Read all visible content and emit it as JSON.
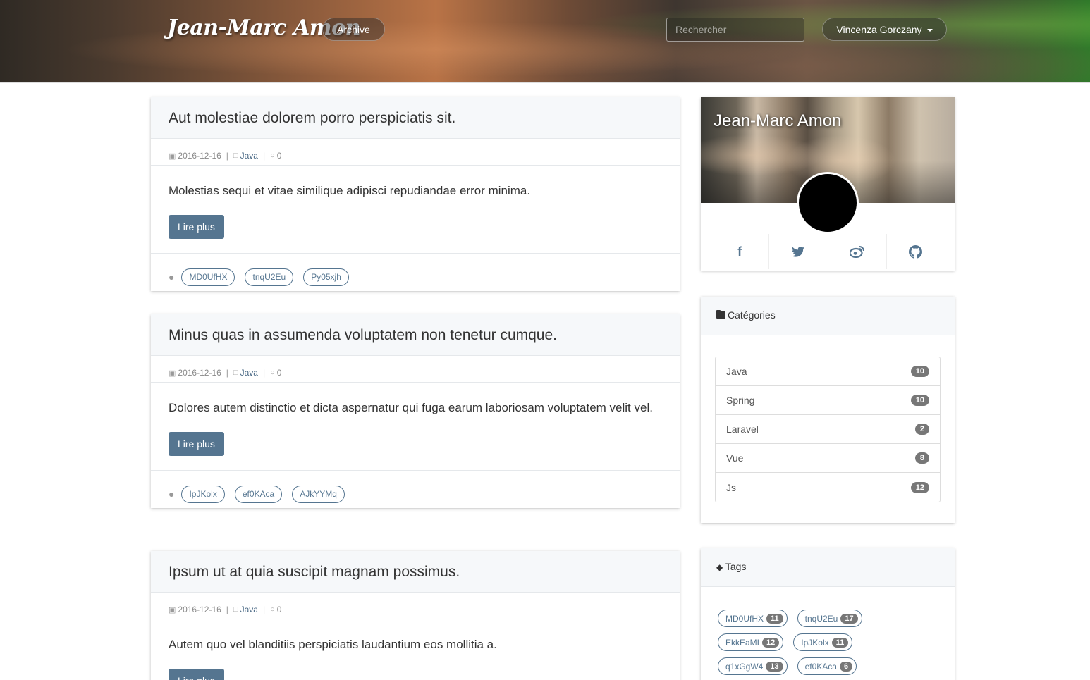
{
  "header": {
    "brand": "Jean-Marc Amon",
    "archive_label": "Archive",
    "search_placeholder": "Rechercher",
    "user_name": "Vincenza Gorczany"
  },
  "posts": [
    {
      "title": "Aut molestiae dolorem porro perspiciatis sit.",
      "date": "2016-12-16",
      "category": "Java",
      "comments": "0",
      "excerpt": "Molestias sequi et vitae similique adipisci repudiandae error minima.",
      "more_label": "Lire plus",
      "tags": [
        "MD0UfHX",
        "tnqU2Eu",
        "Py05xjh"
      ]
    },
    {
      "title": "Minus quas in assumenda voluptatem non tenetur cumque.",
      "date": "2016-12-16",
      "category": "Java",
      "comments": "0",
      "excerpt": "Dolores autem distinctio et dicta aspernatur qui fuga earum laboriosam voluptatem velit vel.",
      "more_label": "Lire plus",
      "tags": [
        "IpJKolx",
        "ef0KAca",
        "AJkYYMq"
      ]
    },
    {
      "title": "Ipsum ut at quia suscipit magnam possimus.",
      "date": "2016-12-16",
      "category": "Java",
      "comments": "0",
      "excerpt": "Autem quo vel blanditiis perspiciatis laudantium eos mollitia a.",
      "more_label": "Lire plus",
      "tags": []
    }
  ],
  "profile": {
    "name": "Jean-Marc Amon",
    "socials": [
      "facebook-icon",
      "twitter-icon",
      "weibo-icon",
      "github-icon"
    ]
  },
  "categories": {
    "title": "Catégories",
    "items": [
      {
        "label": "Java",
        "count": "10"
      },
      {
        "label": "Spring",
        "count": "10"
      },
      {
        "label": "Laravel",
        "count": "2"
      },
      {
        "label": "Vue",
        "count": "8"
      },
      {
        "label": "Js",
        "count": "12"
      }
    ]
  },
  "tags": {
    "title": "Tags",
    "items": [
      {
        "label": "MD0UfHX",
        "count": "11"
      },
      {
        "label": "tnqU2Eu",
        "count": "17"
      },
      {
        "label": "EkkEaMI",
        "count": "12"
      },
      {
        "label": "IpJKolx",
        "count": "11"
      },
      {
        "label": "q1xGgW4",
        "count": "13"
      },
      {
        "label": "ef0KAca",
        "count": "6"
      }
    ]
  },
  "colors": {
    "accent": "#557590",
    "badge": "#777777"
  }
}
